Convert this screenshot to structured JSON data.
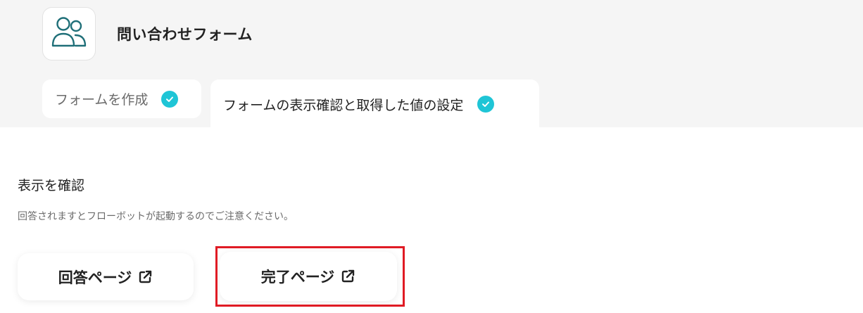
{
  "header": {
    "app_icon": "users-icon",
    "title": "問い合わせフォーム"
  },
  "tabs": [
    {
      "label": "フォームを作成",
      "status_icon": "check-circle-icon",
      "active": false
    },
    {
      "label": "フォームの表示確認と取得した値の設定",
      "status_icon": "check-circle-icon",
      "active": true
    }
  ],
  "section": {
    "title": "表示を確認",
    "note": "回答されますとフローボットが起動するのでご注意ください。"
  },
  "buttons": {
    "answer_page": {
      "label": "回答ページ",
      "icon": "external-link-icon"
    },
    "complete_page": {
      "label": "完了ページ",
      "icon": "external-link-icon"
    }
  },
  "colors": {
    "background_band": "#f5f5f5",
    "check_accent": "#1fc5d6",
    "icon_teal": "#1f6f78",
    "highlight_red": "#e01b24"
  }
}
